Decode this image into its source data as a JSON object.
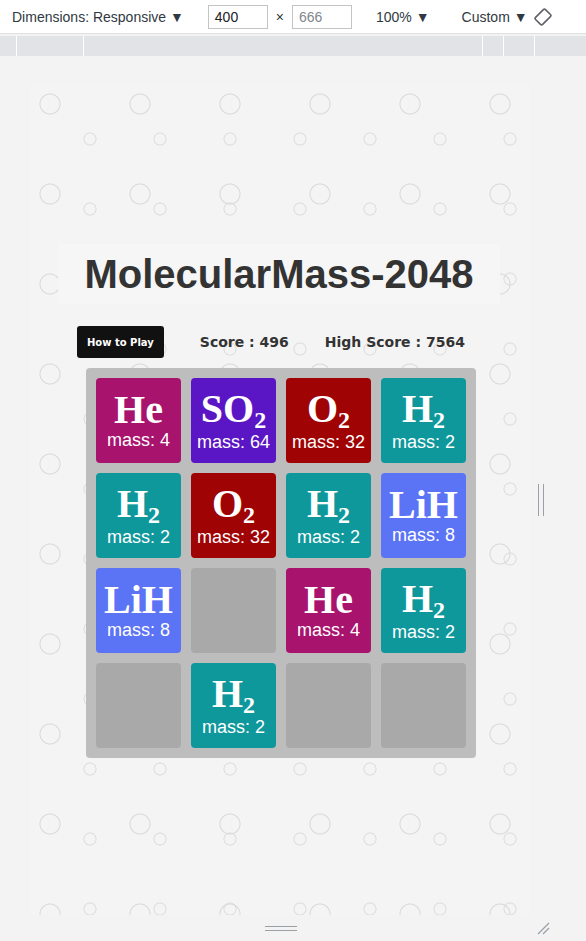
{
  "toolbar": {
    "dimensions": "Dimensions: Responsive ▼",
    "width": "400",
    "times": "×",
    "height": "666",
    "zoom": "100% ▼",
    "throttle": "Custom ▼"
  },
  "game": {
    "title": "MolecularMass-2048",
    "help_button": "How to Play",
    "score": "Score : 496",
    "high_score": "High Score : 7564",
    "tiles": [
      {
        "kind": "molecule",
        "symbol": "He",
        "sub": "",
        "mass": "mass: 4",
        "color": "#a8136e"
      },
      {
        "kind": "molecule",
        "symbol": "SO",
        "sub": "2",
        "mass": "mass: 64",
        "color": "#5a16c4"
      },
      {
        "kind": "molecule",
        "symbol": "O",
        "sub": "2",
        "mass": "mass: 32",
        "color": "#a00303"
      },
      {
        "kind": "molecule",
        "symbol": "H",
        "sub": "2",
        "mass": "mass: 2",
        "color": "#0e989c"
      },
      {
        "kind": "molecule",
        "symbol": "H",
        "sub": "2",
        "mass": "mass: 2",
        "color": "#0e989c"
      },
      {
        "kind": "molecule",
        "symbol": "O",
        "sub": "2",
        "mass": "mass: 32",
        "color": "#a00303"
      },
      {
        "kind": "molecule",
        "symbol": "H",
        "sub": "2",
        "mass": "mass: 2",
        "color": "#0e989c"
      },
      {
        "kind": "molecule",
        "symbol": "LiH",
        "sub": "",
        "mass": "mass: 8",
        "color": "#5b73f5"
      },
      {
        "kind": "molecule",
        "symbol": "LiH",
        "sub": "",
        "mass": "mass: 8",
        "color": "#5b73f5"
      },
      {
        "kind": "empty"
      },
      {
        "kind": "molecule",
        "symbol": "He",
        "sub": "",
        "mass": "mass: 4",
        "color": "#a8136e"
      },
      {
        "kind": "molecule",
        "symbol": "H",
        "sub": "2",
        "mass": "mass: 2",
        "color": "#0e989c"
      },
      {
        "kind": "empty"
      },
      {
        "kind": "molecule",
        "symbol": "H",
        "sub": "2",
        "mass": "mass: 2",
        "color": "#0e989c"
      },
      {
        "kind": "empty"
      },
      {
        "kind": "empty"
      }
    ]
  }
}
